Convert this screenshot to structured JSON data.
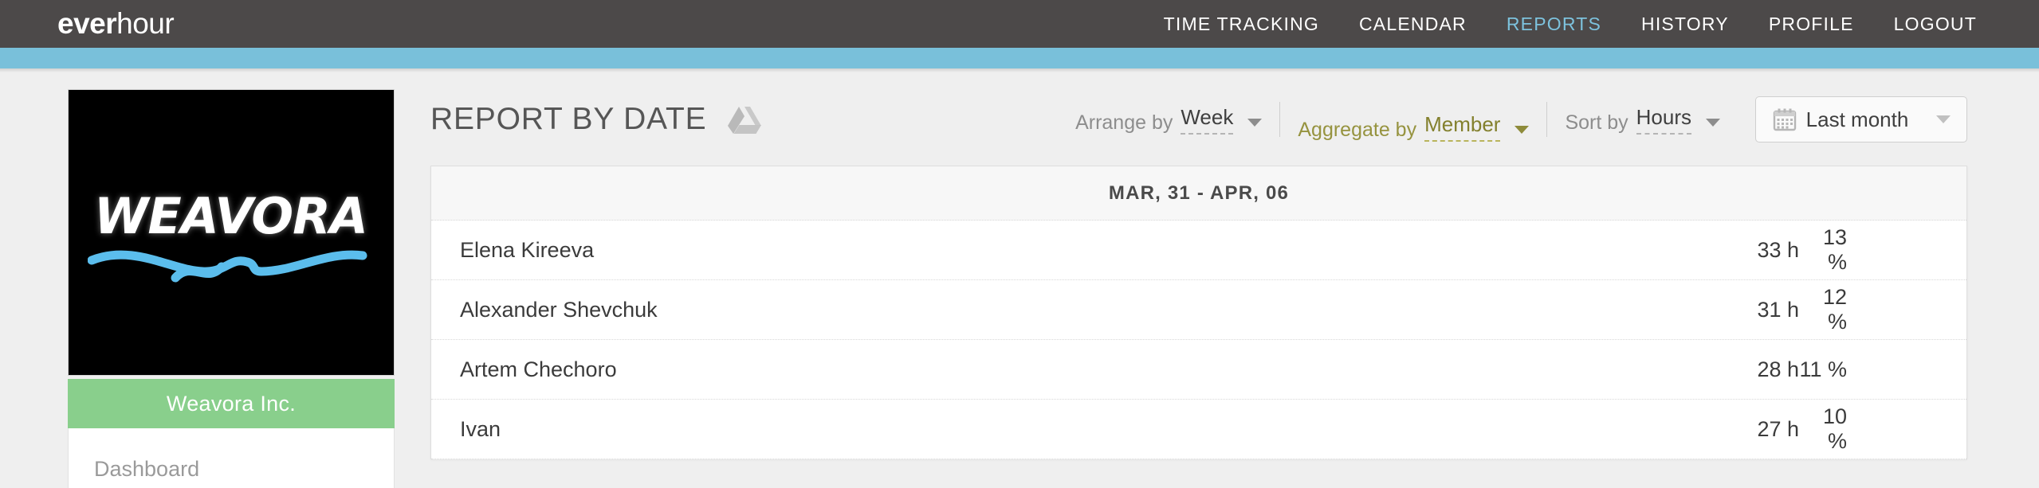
{
  "header": {
    "brand_bold": "ever",
    "brand_thin": "hour",
    "nav": [
      {
        "label": "TIME TRACKING",
        "active": false
      },
      {
        "label": "CALENDAR",
        "active": false
      },
      {
        "label": "REPORTS",
        "active": true
      },
      {
        "label": "HISTORY",
        "active": false
      },
      {
        "label": "PROFILE",
        "active": false
      },
      {
        "label": "LOGOUT",
        "active": false
      }
    ],
    "accent_color": "#7dc2dd",
    "bar_color": "#4c4949",
    "strip_color": "#79c0da"
  },
  "sidebar": {
    "logo_text": "WEAVORA",
    "company_name": "Weavora Inc.",
    "company_bar_color": "#89cf8c",
    "items": [
      {
        "label": "Dashboard"
      }
    ]
  },
  "main": {
    "page_title": "REPORT BY DATE",
    "gdrive_icon": "google-drive-icon",
    "controls": [
      {
        "label": "Arrange by",
        "value": "Week",
        "highlighted": false
      },
      {
        "label": "Aggregate by",
        "value": "Member",
        "highlighted": true
      },
      {
        "label": "Sort by",
        "value": "Hours",
        "highlighted": false
      }
    ],
    "date_range": {
      "icon": "calendar-icon",
      "value": "Last month"
    },
    "highlight_color": "#f2ee86"
  },
  "report": {
    "period_label": "MAR, 31 - APR, 06",
    "rows": [
      {
        "name": "Elena Kireeva",
        "hours": "33 h",
        "percent": "13 %"
      },
      {
        "name": "Alexander Shevchuk",
        "hours": "31 h",
        "percent": "12 %"
      },
      {
        "name": "Artem Chechoro",
        "hours": "28 h",
        "percent": "11 %"
      },
      {
        "name": "Ivan",
        "hours": "27 h",
        "percent": "10 %"
      }
    ]
  },
  "chart_data": {
    "type": "table",
    "title": "MAR, 31 - APR, 06",
    "categories": [
      "Elena Kireeva",
      "Alexander Shevchuk",
      "Artem Chechoro",
      "Ivan"
    ],
    "series": [
      {
        "name": "Hours",
        "values": [
          33,
          31,
          28,
          27
        ]
      },
      {
        "name": "Percent",
        "values": [
          13,
          12,
          11,
          10
        ]
      }
    ],
    "xlabel": "Member",
    "ylabel": "Hours"
  }
}
